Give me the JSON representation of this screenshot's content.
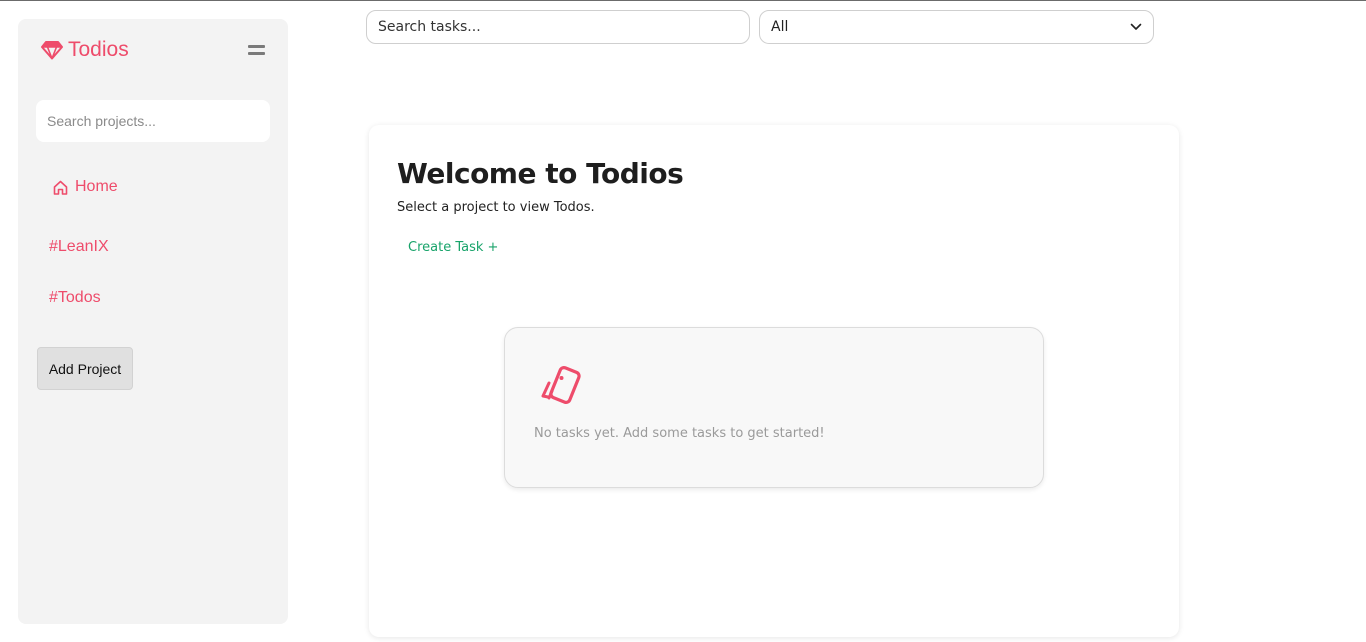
{
  "brand": {
    "name": "Todios",
    "icon": "gem-icon",
    "color": "#ee4c6b"
  },
  "sidebar": {
    "search_placeholder": "Search projects...",
    "home_label": "Home",
    "projects": [
      "#LeanIX",
      "#Todos"
    ],
    "add_project_label": "Add Project"
  },
  "filters": {
    "task_search_placeholder": "Search tasks...",
    "status_value": "All"
  },
  "main": {
    "title": "Welcome to Todios",
    "subtitle": "Select a project to view Todos.",
    "create_task_label": "Create Task +",
    "empty_state": "No tasks yet. Add some tasks to get started!"
  },
  "colors": {
    "accent": "#ee4c6b",
    "create_task": "#18a36a"
  }
}
